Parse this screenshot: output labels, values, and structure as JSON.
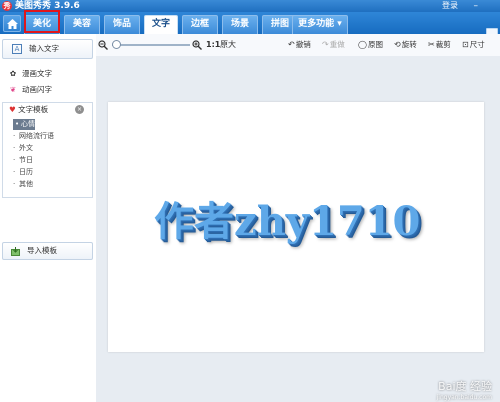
{
  "titlebar": {
    "app_icon_glyph": "秀",
    "title": "美图秀秀 3.9.6",
    "login": "登录",
    "dash": "–"
  },
  "menu": {
    "tabs": [
      {
        "label": "美化"
      },
      {
        "label": "美容"
      },
      {
        "label": "饰品"
      },
      {
        "label": "文字"
      },
      {
        "label": "边框"
      },
      {
        "label": "场景"
      },
      {
        "label": "拼图"
      },
      {
        "label": "更多功能 ▾"
      }
    ],
    "active_tab": "文字",
    "accent_color": "#1f6fc0",
    "highlight_color": "#e0161c"
  },
  "toolbar": {
    "ratio_label": "1:1",
    "ratio_text": "原大",
    "undo": "撤销",
    "redo": "重做",
    "original": "原图",
    "rotate": "旋转",
    "crop": "裁剪",
    "size": "尺寸"
  },
  "sidebar": {
    "input_text": "输入文字",
    "comic_text": "漫画文字",
    "animated_text": "动画闪字",
    "template_title": "文字模板",
    "template_items": [
      "心情",
      "网络流行语",
      "外文",
      "节日",
      "日历",
      "其他"
    ],
    "selected_template": "心情",
    "import_template": "导入模板"
  },
  "canvas": {
    "text": "作者zhy1710",
    "text_color": "#5ea8e8"
  },
  "watermark": {
    "main": "Bai度 经验",
    "sub": "jingyan.baidu.com"
  }
}
